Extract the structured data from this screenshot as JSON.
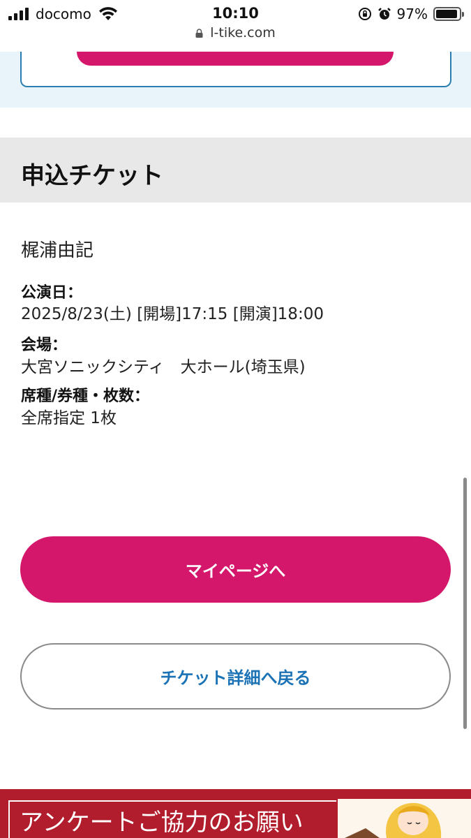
{
  "status_bar": {
    "carrier": "docomo",
    "time": "10:10",
    "url": "l-tike.com",
    "battery_percent": "97%",
    "icons": [
      "signal-icon",
      "wifi-icon",
      "lock-icon",
      "orientation-lock-icon",
      "alarm-icon",
      "battery-icon"
    ]
  },
  "section": {
    "title": "申込チケット"
  },
  "ticket": {
    "artist": "梶浦由記",
    "date_label": "公演日：",
    "date_value": "2025/8/23(土) [開場]17:15 [開演]18:00",
    "venue_label": "会場：",
    "venue_value": "大宮ソニックシティ　大ホール(埼玉県)",
    "seat_label": "席種/券種・枚数：",
    "seat_value": "全席指定 1枚"
  },
  "buttons": {
    "mypage": "マイページへ",
    "back_to_detail": "チケット詳細へ戻る"
  },
  "banner": {
    "text": "アンケートご協力のお願い"
  },
  "colors": {
    "accent": "#d4176b",
    "link_blue": "#1b72b5",
    "banner_red": "#b11d2c",
    "light_blue_bg": "#e9f3fa",
    "heading_bg": "#e8e8e8"
  }
}
